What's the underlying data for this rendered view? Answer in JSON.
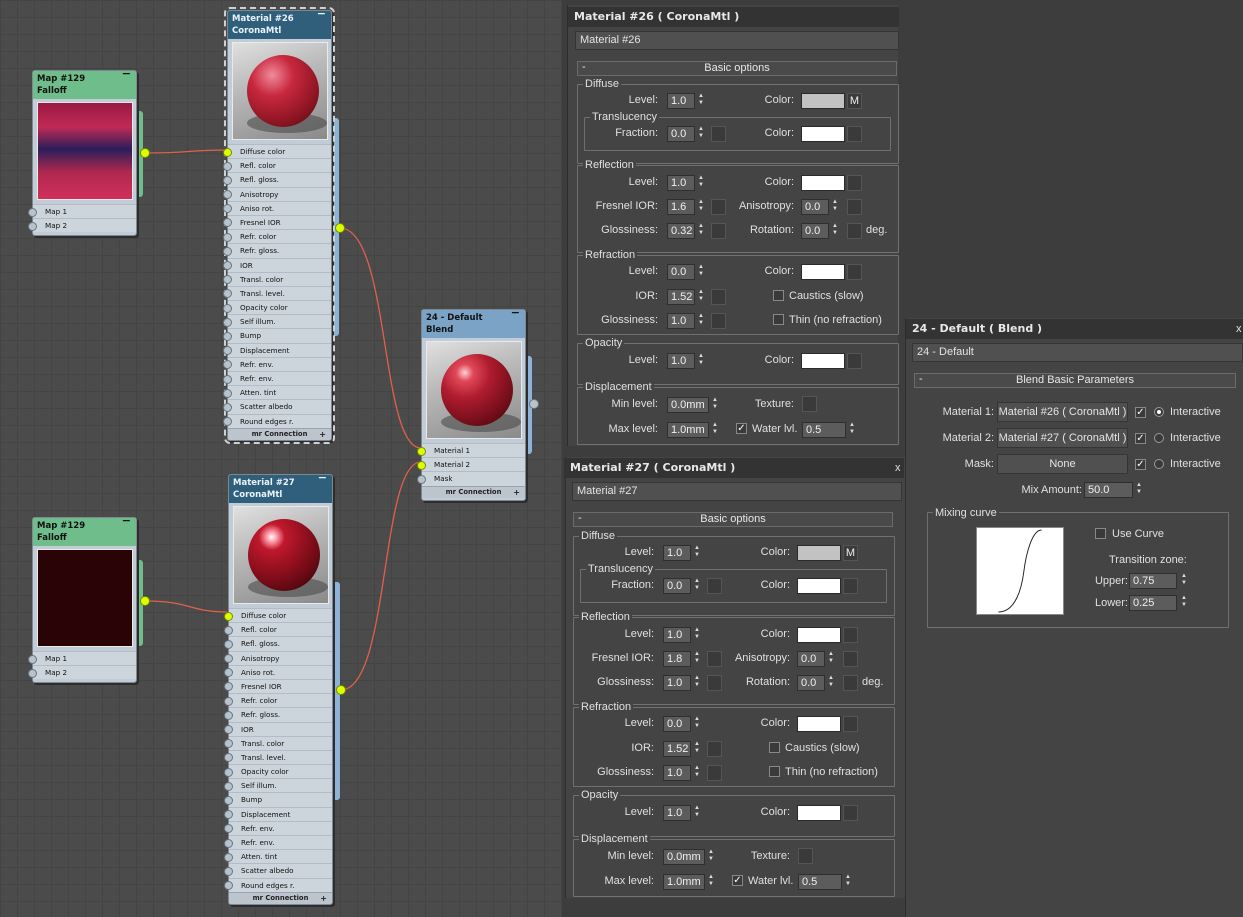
{
  "nodes": {
    "mat26": {
      "title1": "Material #26",
      "title2": "CoronaMtl",
      "min": "−"
    },
    "mat27": {
      "title1": "Material #27",
      "title2": "CoronaMtl",
      "min": "−"
    },
    "blend": {
      "title1": "24 - Default",
      "title2": "Blend",
      "min": "−",
      "slots": [
        "Material 1",
        "Material 2",
        "Mask"
      ],
      "footer": "mr Connection",
      "plus": "+"
    },
    "map_top": {
      "title1": "Map #129",
      "title2": "Falloff",
      "min": "−",
      "slots": [
        "Map 1",
        "Map 2"
      ]
    },
    "map_bottom": {
      "title1": "Map #129",
      "title2": "Falloff",
      "min": "−",
      "slots": [
        "Map 1",
        "Map 2"
      ]
    },
    "corona_slots": [
      "Diffuse color",
      "Refl. color",
      "Refl. gloss.",
      "Anisotropy",
      "Aniso rot.",
      "Fresnel IOR",
      "Refr. color",
      "Refr. gloss.",
      "IOR",
      "Transl. color",
      "Transl. level.",
      "Opacity color",
      "Self illum.",
      "Bump",
      "Displacement",
      "Refr. env.",
      "Refr. env.",
      "Atten. tint",
      "Scatter albedo",
      "Round edges r."
    ],
    "corona_footer": "mr Connection",
    "corona_plus": "+"
  },
  "panels": {
    "mat26": {
      "title": "Material #26  ( CoronaMtl )",
      "name": "Material #26",
      "rollout": "Basic options",
      "collapse": "-",
      "diffuse": {
        "group": "Diffuse",
        "level_label": "Level:",
        "level": "1.0",
        "color_label": "Color:",
        "map_btn": "M"
      },
      "translucency": {
        "group": "Translucency",
        "fraction_label": "Fraction:",
        "fraction": "0.0",
        "color_label": "Color:"
      },
      "reflection": {
        "group": "Reflection",
        "level_label": "Level:",
        "level": "1.0",
        "color_label": "Color:",
        "fresnel_label": "Fresnel IOR:",
        "fresnel": "1.6",
        "aniso_label": "Anisotropy:",
        "aniso": "0.0",
        "gloss_label": "Glossiness:",
        "gloss": "0.32",
        "rot_label": "Rotation:",
        "rot": "0.0",
        "deg": "deg."
      },
      "refraction": {
        "group": "Refraction",
        "level_label": "Level:",
        "level": "0.0",
        "color_label": "Color:",
        "ior_label": "IOR:",
        "ior": "1.52",
        "caustics": "Caustics (slow)",
        "gloss_label": "Glossiness:",
        "gloss": "1.0",
        "thin": "Thin (no refraction)"
      },
      "opacity": {
        "group": "Opacity",
        "level_label": "Level:",
        "level": "1.0",
        "color_label": "Color:"
      },
      "displacement": {
        "group": "Displacement",
        "min_label": "Min level:",
        "min": "0.0mm",
        "texture_label": "Texture:",
        "max_label": "Max level:",
        "max": "1.0mm",
        "water_label": "Water lvl.",
        "water": "0.5"
      }
    },
    "mat27": {
      "title": "Material #27  ( CoronaMtl )",
      "name": "Material #27",
      "rollout": "Basic options",
      "collapse": "-",
      "close": "x",
      "diffuse": {
        "group": "Diffuse",
        "level_label": "Level:",
        "level": "1.0",
        "color_label": "Color:",
        "map_btn": "M"
      },
      "translucency": {
        "group": "Translucency",
        "fraction_label": "Fraction:",
        "fraction": "0.0",
        "color_label": "Color:"
      },
      "reflection": {
        "group": "Reflection",
        "level_label": "Level:",
        "level": "1.0",
        "color_label": "Color:",
        "fresnel_label": "Fresnel IOR:",
        "fresnel": "1.8",
        "aniso_label": "Anisotropy:",
        "aniso": "0.0",
        "gloss_label": "Glossiness:",
        "gloss": "1.0",
        "rot_label": "Rotation:",
        "rot": "0.0",
        "deg": "deg."
      },
      "refraction": {
        "group": "Refraction",
        "level_label": "Level:",
        "level": "0.0",
        "color_label": "Color:",
        "ior_label": "IOR:",
        "ior": "1.52",
        "caustics": "Caustics (slow)",
        "gloss_label": "Glossiness:",
        "gloss": "1.0",
        "thin": "Thin (no refraction)"
      },
      "opacity": {
        "group": "Opacity",
        "level_label": "Level:",
        "level": "1.0",
        "color_label": "Color:"
      },
      "displacement": {
        "group": "Displacement",
        "min_label": "Min level:",
        "min": "0.0mm",
        "texture_label": "Texture:",
        "max_label": "Max level:",
        "max": "1.0mm",
        "water_label": "Water lvl.",
        "water": "0.5"
      }
    },
    "blend": {
      "title": "24 - Default  ( Blend )",
      "name": "24 - Default",
      "rollout": "Blend Basic Parameters",
      "collapse": "-",
      "close": "x",
      "mat1_label": "Material 1:",
      "mat1": "Material #26  ( CoronaMtl )",
      "mat2_label": "Material 2:",
      "mat2": "Material #27  ( CoronaMtl )",
      "mask_label": "Mask:",
      "mask": "None",
      "interactive": "Interactive",
      "mix_label": "Mix Amount:",
      "mix": "50.0",
      "curve_group": "Mixing curve",
      "use_curve": "Use Curve",
      "transition": "Transition zone:",
      "upper_label": "Upper:",
      "upper": "0.75",
      "lower_label": "Lower:",
      "lower": "0.25"
    }
  },
  "colors": {
    "diffuse_swatch": "#c2c2c2",
    "white_swatch": "#ffffff",
    "wire": "#e0604a",
    "slot_active": "#d9ff00"
  }
}
